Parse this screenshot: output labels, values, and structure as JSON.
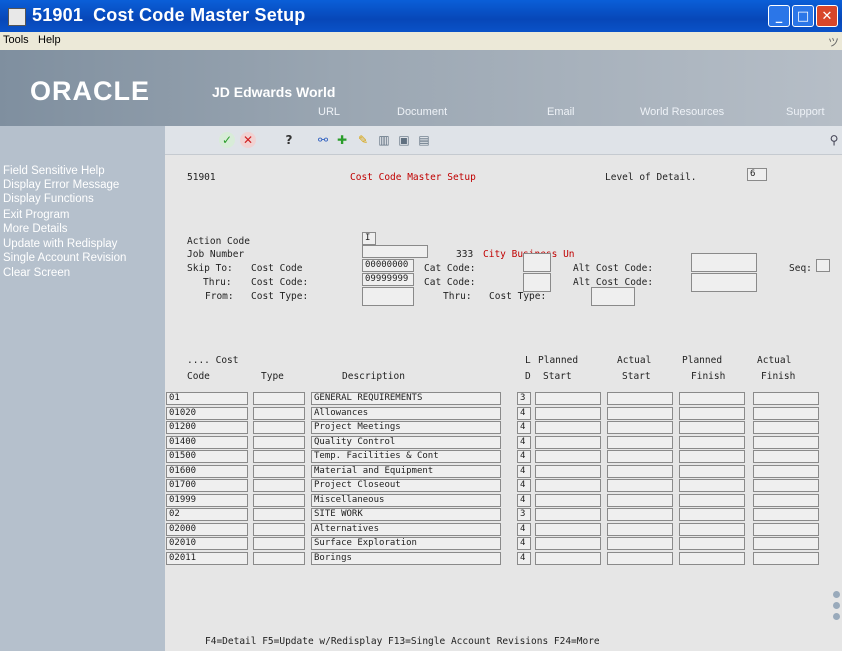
{
  "window": {
    "program_number": "51901",
    "title": "Cost Code Master Setup",
    "buttons": {
      "minimize": "_",
      "maximize": "□",
      "close": "✕"
    }
  },
  "menubar": {
    "items": [
      "Tools",
      "Help"
    ],
    "right_glyph": "ツ"
  },
  "banner": {
    "logo": "ORACLE",
    "product": "JD Edwards World",
    "links": [
      "URL",
      "Document",
      "Email",
      "World Resources",
      "Support"
    ]
  },
  "left_panel": {
    "items": [
      "Field Sensitive Help",
      "Display Error Message",
      "Display Functions",
      "Exit Program",
      "More Details",
      "Update with Redisplay",
      "Single Account Revision",
      "Clear Screen"
    ]
  },
  "toolbar": {
    "icons": [
      "check-icon",
      "cancel-icon",
      "help-icon",
      "binoculars-icon",
      "add-icon",
      "edit-icon",
      "delete-icon",
      "print-icon",
      "export-icon",
      "search-icon"
    ]
  },
  "form": {
    "program_id": "51901",
    "screen_title": "Cost Code Master Setup",
    "level_of_detail_label": "Level of Detail.",
    "level_of_detail_value": "6",
    "action_code_label": "Action Code",
    "action_code_value": "I",
    "job_number_label": "Job Number",
    "job_number_value": "",
    "job_number_code": "333",
    "job_number_desc": "City Business Un",
    "skip_to_label": "Skip To:",
    "cost_code_label": "Cost Code",
    "cost_code_from": "00000000",
    "cat_code_label": "Cat Code:",
    "alt_cost_code_label": "Alt Cost Code:",
    "seq_label": "Seq:",
    "thru_label": "Thru:",
    "cost_code_thru_label": "Cost Code:",
    "cost_code_thru": "09999999",
    "cat_code_thru_label": "Cat Code:",
    "alt_cost_code_thru_label": "Alt Cost Code:",
    "from_label": "From:",
    "cost_type_label": "Cost Type:",
    "thru2_label": "Thru:",
    "cost_type_thru_label": "Cost Type:"
  },
  "grid": {
    "header_top": [
      ".... Cost",
      "L",
      "Planned",
      "Actual",
      "Planned",
      "Actual"
    ],
    "header_bottom": [
      "Code",
      "Type",
      "Description",
      "D",
      "Start",
      "Start",
      "Finish",
      "Finish"
    ],
    "rows": [
      {
        "code": "01",
        "type": "",
        "desc": "GENERAL REQUIREMENTS",
        "ld": "3"
      },
      {
        "code": "01020",
        "type": "",
        "desc": " Allowances",
        "ld": "4"
      },
      {
        "code": "01200",
        "type": "",
        "desc": " Project Meetings",
        "ld": "4"
      },
      {
        "code": "01400",
        "type": "",
        "desc": " Quality Control",
        "ld": "4"
      },
      {
        "code": "01500",
        "type": "",
        "desc": " Temp. Facilities & Cont",
        "ld": "4"
      },
      {
        "code": "01600",
        "type": "",
        "desc": " Material and Equipment",
        "ld": "4"
      },
      {
        "code": "01700",
        "type": "",
        "desc": " Project Closeout",
        "ld": "4"
      },
      {
        "code": "01999",
        "type": "",
        "desc": " Miscellaneous",
        "ld": "4"
      },
      {
        "code": "02",
        "type": "",
        "desc": "SITE WORK",
        "ld": "3"
      },
      {
        "code": "02000",
        "type": "",
        "desc": " Alternatives",
        "ld": "4"
      },
      {
        "code": "02010",
        "type": "",
        "desc": " Surface Exploration",
        "ld": "4"
      },
      {
        "code": "02011",
        "type": "",
        "desc": " Borings",
        "ld": "4"
      }
    ]
  },
  "footer": {
    "function_keys": "F4=Detail  F5=Update w/Redisplay  F13=Single Account Revisions  F24=More"
  },
  "colors": {
    "title_bar": "#0747b8",
    "left_panel": "#b5c0cc",
    "content_bg": "#e6e6e6",
    "accent_red": "#c00000"
  }
}
